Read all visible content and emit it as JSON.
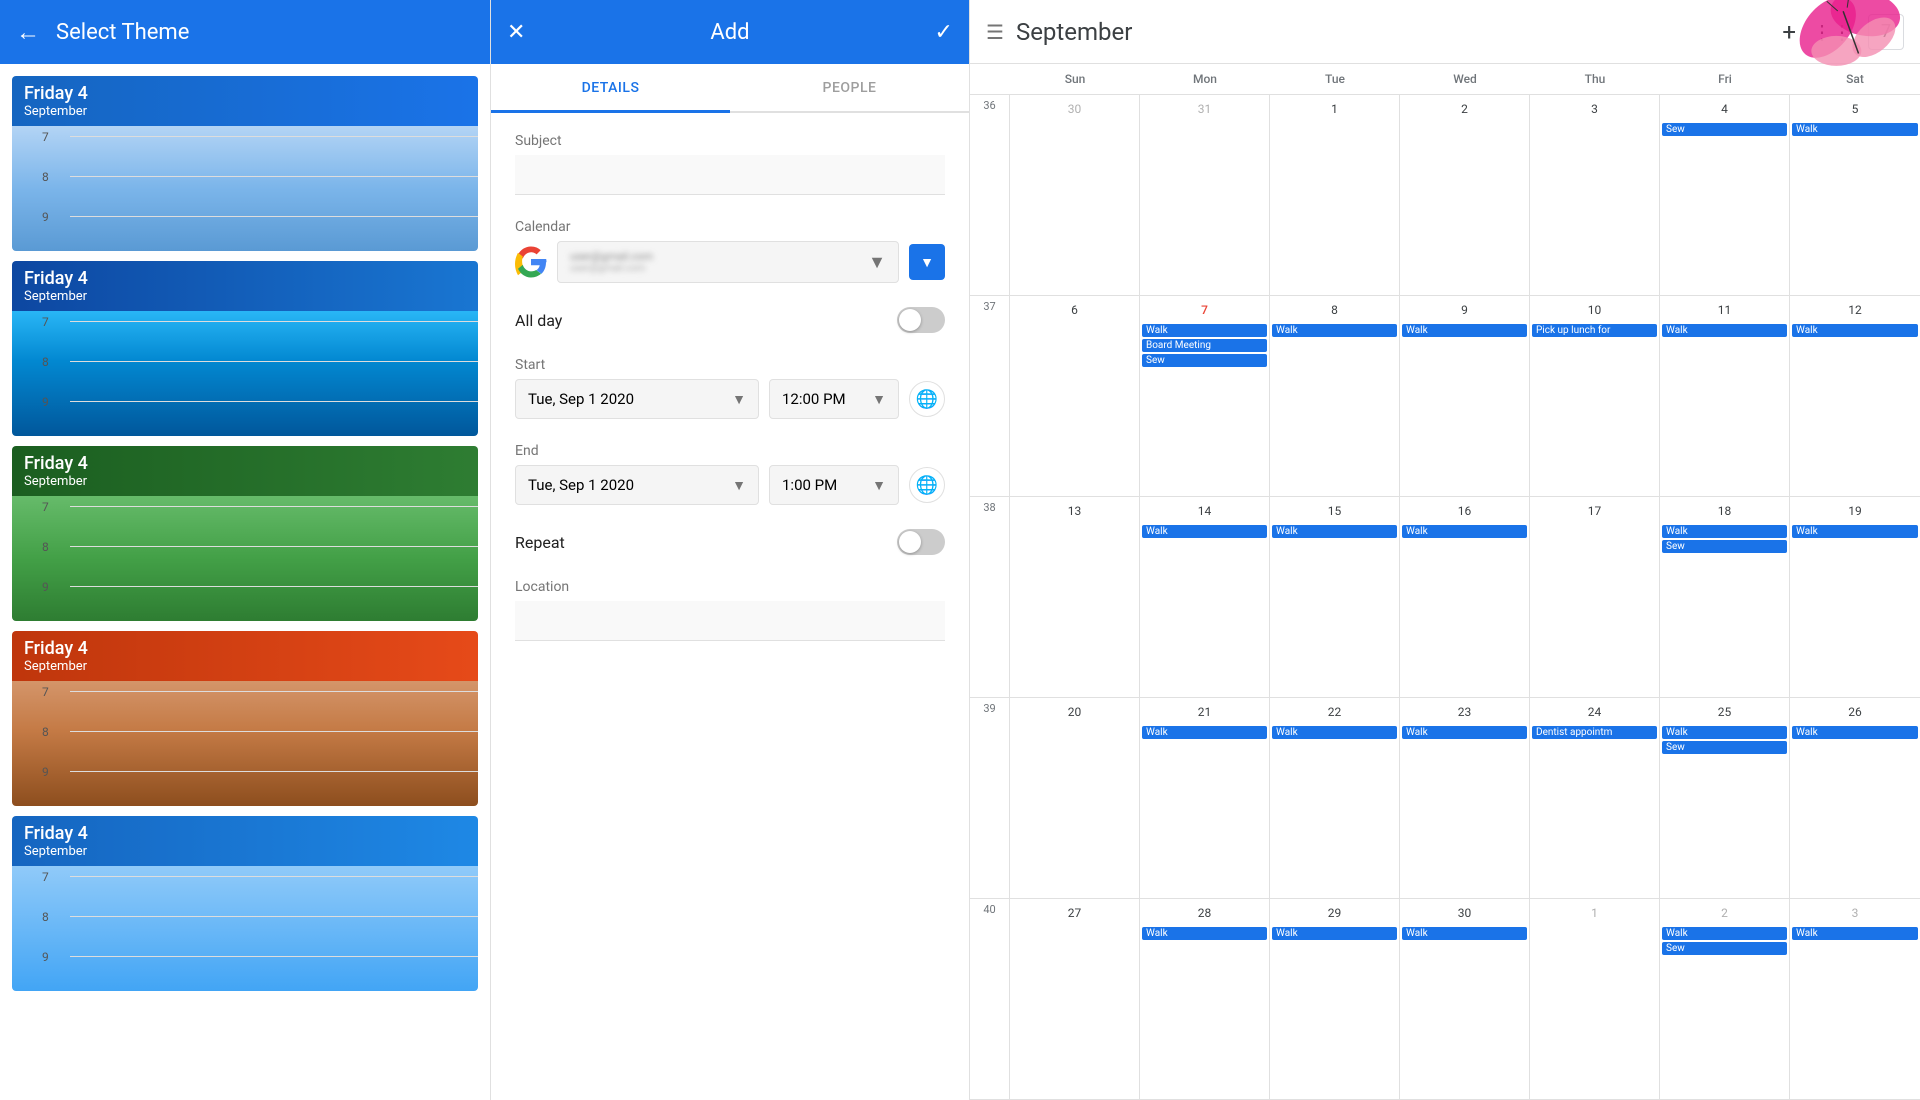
{
  "left": {
    "title": "Select Theme",
    "back_icon": "←",
    "themes": [
      {
        "id": 1,
        "day": "Friday 4",
        "month": "September",
        "color_class": "theme-1",
        "times": [
          "7",
          "8",
          "9"
        ]
      },
      {
        "id": 2,
        "day": "Friday 4",
        "month": "September",
        "color_class": "theme-2",
        "times": [
          "7",
          "8",
          "9"
        ]
      },
      {
        "id": 3,
        "day": "Friday 4",
        "month": "September",
        "color_class": "theme-3",
        "times": [
          "7",
          "8",
          "9"
        ]
      },
      {
        "id": 4,
        "day": "Friday 4",
        "month": "September",
        "color_class": "theme-4",
        "times": [
          "7",
          "8",
          "9"
        ]
      },
      {
        "id": 5,
        "day": "Friday 4",
        "month": "September",
        "color_class": "theme-5",
        "times": [
          "7",
          "8",
          "9"
        ]
      }
    ]
  },
  "middle": {
    "title": "Add",
    "close_icon": "✕",
    "check_icon": "✓",
    "tabs": [
      {
        "id": "details",
        "label": "DETAILS",
        "active": true
      },
      {
        "id": "people",
        "label": "PEOPLE",
        "active": false
      }
    ],
    "subject_label": "Subject",
    "subject_placeholder": "",
    "calendar_label": "Calendar",
    "calendar_email": "user@gmail.com",
    "calendar_email2": "user@gmail.com",
    "all_day_label": "All day",
    "start_label": "Start",
    "start_date": "Tue, Sep 1 2020",
    "start_time": "12:00 PM",
    "end_label": "End",
    "end_date": "Tue, Sep 1 2020",
    "end_time": "1:00 PM",
    "repeat_label": "Repeat",
    "location_label": "Location",
    "location_placeholder": ""
  },
  "right": {
    "title": "September",
    "plus_icon": "+",
    "menu_icon": "⋮",
    "hamburger_icon": "☰",
    "calendar_icon": "7",
    "dow_headers": [
      "Sun",
      "Mon",
      "Tue",
      "Wed",
      "Thu",
      "Fri",
      "Sat"
    ],
    "weeks": [
      {
        "week_num": "36",
        "days": [
          {
            "num": "30",
            "gray": true,
            "events": []
          },
          {
            "num": "31",
            "gray": true,
            "events": []
          },
          {
            "num": "1",
            "events": []
          },
          {
            "num": "2",
            "events": []
          },
          {
            "num": "3",
            "events": []
          },
          {
            "num": "4",
            "events": [
              {
                "label": "Sew",
                "color": "blue"
              }
            ]
          },
          {
            "num": "5",
            "events": [
              {
                "label": "Walk",
                "color": "blue"
              }
            ]
          }
        ]
      },
      {
        "week_num": "37",
        "days": [
          {
            "num": "6",
            "events": []
          },
          {
            "num": "7",
            "red": true,
            "events": [
              {
                "label": "Walk",
                "color": "blue"
              }
            ]
          },
          {
            "num": "8",
            "events": [
              {
                "label": "Walk",
                "color": "blue"
              }
            ]
          },
          {
            "num": "9",
            "events": [
              {
                "label": "Walk",
                "color": "blue"
              }
            ]
          },
          {
            "num": "10",
            "events": [
              {
                "label": "Pick up lunch for",
                "color": "blue"
              }
            ]
          },
          {
            "num": "11",
            "events": [
              {
                "label": "Walk",
                "color": "blue"
              }
            ]
          },
          {
            "num": "12",
            "events": [
              {
                "label": "Walk",
                "color": "blue"
              }
            ]
          }
        ],
        "extra_events": {
          "7": [
            {
              "label": "Board Meeting",
              "color": "blue"
            },
            {
              "label": "Sew",
              "color": "blue"
            }
          ]
        }
      },
      {
        "week_num": "38",
        "days": [
          {
            "num": "13",
            "events": []
          },
          {
            "num": "14",
            "events": [
              {
                "label": "Walk",
                "color": "blue"
              }
            ]
          },
          {
            "num": "15",
            "events": [
              {
                "label": "Walk",
                "color": "blue"
              }
            ]
          },
          {
            "num": "16",
            "events": [
              {
                "label": "Walk",
                "color": "blue"
              }
            ]
          },
          {
            "num": "17",
            "events": []
          },
          {
            "num": "18",
            "events": [
              {
                "label": "Walk",
                "color": "blue"
              },
              {
                "label": "Sew",
                "color": "blue"
              }
            ]
          },
          {
            "num": "19",
            "events": [
              {
                "label": "Walk",
                "color": "blue"
              }
            ]
          }
        ]
      },
      {
        "week_num": "39",
        "days": [
          {
            "num": "20",
            "events": []
          },
          {
            "num": "21",
            "events": [
              {
                "label": "Walk",
                "color": "blue"
              }
            ]
          },
          {
            "num": "22",
            "events": [
              {
                "label": "Walk",
                "color": "blue"
              }
            ]
          },
          {
            "num": "23",
            "events": [
              {
                "label": "Walk",
                "color": "blue"
              }
            ]
          },
          {
            "num": "24",
            "events": [
              {
                "label": "Dentist appointm",
                "color": "blue"
              }
            ]
          },
          {
            "num": "25",
            "events": [
              {
                "label": "Walk",
                "color": "blue"
              },
              {
                "label": "Sew",
                "color": "blue"
              }
            ]
          },
          {
            "num": "26",
            "events": [
              {
                "label": "Walk",
                "color": "blue"
              }
            ]
          }
        ]
      },
      {
        "week_num": "40",
        "days": [
          {
            "num": "27",
            "events": []
          },
          {
            "num": "28",
            "events": [
              {
                "label": "Walk",
                "color": "blue"
              }
            ]
          },
          {
            "num": "29",
            "events": [
              {
                "label": "Walk",
                "color": "blue"
              }
            ]
          },
          {
            "num": "30",
            "events": [
              {
                "label": "Walk",
                "color": "blue"
              }
            ]
          },
          {
            "num": "1",
            "gray": true,
            "events": []
          },
          {
            "num": "2",
            "gray": true,
            "events": [
              {
                "label": "Walk",
                "color": "blue"
              }
            ]
          },
          {
            "num": "3",
            "gray": true,
            "events": [
              {
                "label": "Walk",
                "color": "blue"
              }
            ]
          }
        ],
        "extra_events": {
          "25": [
            {
              "label": "Sew",
              "color": "blue"
            }
          ]
        }
      }
    ]
  }
}
